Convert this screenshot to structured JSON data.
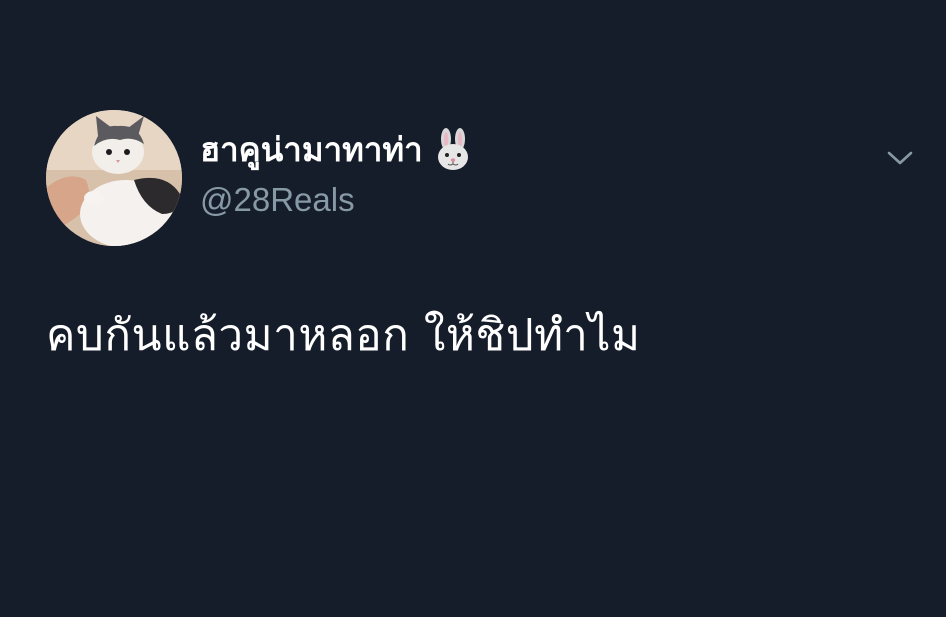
{
  "author": {
    "display_name": "ฮาคูน่ามาทาท่า",
    "name_emoji": "rabbit-face-icon",
    "handle": "@28Reals",
    "avatar": "cat-avatar"
  },
  "tweet": {
    "text": "คบกันแล้วมาหลอก ให้ชิปทำไม"
  },
  "menu": {
    "icon": "chevron-down-icon"
  },
  "colors": {
    "background": "#151c2a",
    "primary_text": "#ffffff",
    "secondary_text": "#8899a6",
    "chevron": "#8899a6"
  }
}
